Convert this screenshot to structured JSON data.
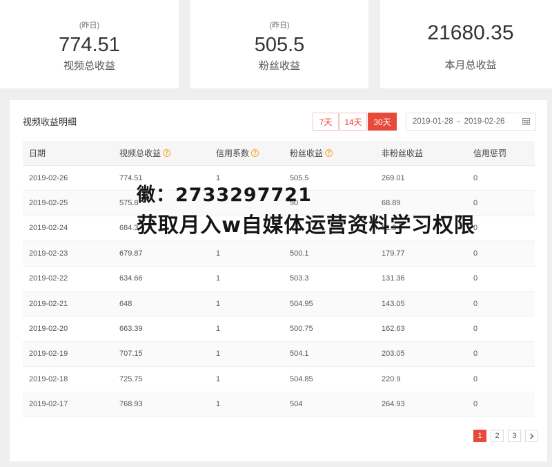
{
  "stats": {
    "video_total": {
      "tag": "(昨日)",
      "value": "774.51",
      "label": "视频总收益"
    },
    "fan_income": {
      "tag": "(昨日)",
      "value": "505.5",
      "label": "粉丝收益"
    },
    "month_total": {
      "value": "21680.35",
      "label": "本月总收益"
    }
  },
  "detail": {
    "title": "视频收益明细",
    "range_buttons": [
      {
        "label": "7天",
        "active": false
      },
      {
        "label": "14天",
        "active": false
      },
      {
        "label": "30天",
        "active": true
      }
    ],
    "date_range": {
      "start": "2019-01-28",
      "separator": "-",
      "end": "2019-02-26",
      "icon": "calendar-icon"
    },
    "help_icon": "question-circle-icon",
    "columns": [
      {
        "label": "日期",
        "help": false
      },
      {
        "label": "视频总收益",
        "help": true
      },
      {
        "label": "信用系数",
        "help": true
      },
      {
        "label": "粉丝收益",
        "help": true
      },
      {
        "label": "非粉丝收益",
        "help": false
      },
      {
        "label": "信用惩罚",
        "help": false
      }
    ],
    "rows": [
      [
        "2019-02-26",
        "774.51",
        "1",
        "505.5",
        "269.01",
        "0"
      ],
      [
        "2019-02-25",
        "575.8",
        "",
        "50",
        "68.89",
        "0"
      ],
      [
        "2019-02-24",
        "684.3",
        "",
        "",
        "81.3",
        "0"
      ],
      [
        "2019-02-23",
        "679.87",
        "1",
        "500.1",
        "179.77",
        "0"
      ],
      [
        "2019-02-22",
        "634.66",
        "1",
        "503.3",
        "131.36",
        "0"
      ],
      [
        "2019-02-21",
        "648",
        "1",
        "504.95",
        "143.05",
        "0"
      ],
      [
        "2019-02-20",
        "663.39",
        "1",
        "500.75",
        "162.63",
        "0"
      ],
      [
        "2019-02-19",
        "707.15",
        "1",
        "504.1",
        "203.05",
        "0"
      ],
      [
        "2019-02-18",
        "725.75",
        "1",
        "504.85",
        "220.9",
        "0"
      ],
      [
        "2019-02-17",
        "768.93",
        "1",
        "504",
        "264.93",
        "0"
      ]
    ]
  },
  "pagination": {
    "pages": [
      "1",
      "2",
      "3"
    ],
    "current": "1",
    "next_icon": "chevron-right-icon"
  },
  "watermark": {
    "line1": "徽：2733297721",
    "line2": "获取月入w自媒体运营资料学习权限"
  },
  "colors": {
    "accent": "#e8493a",
    "help_icon": "#f5a623"
  }
}
